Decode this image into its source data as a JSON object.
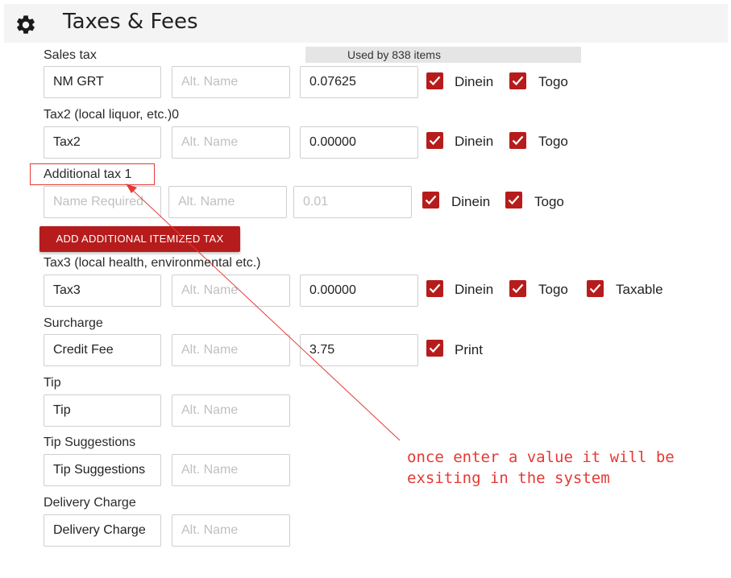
{
  "header": {
    "title": "Taxes & Fees",
    "icon": "gear-icon"
  },
  "used_by": "Used by 838 items",
  "sections": {
    "sales_tax": {
      "label": "Sales tax",
      "name": "NM GRT",
      "alt_placeholder": "Alt. Name",
      "rate": "0.07625",
      "checkboxes": [
        {
          "label": "Dinein",
          "checked": true
        },
        {
          "label": "Togo",
          "checked": true
        }
      ]
    },
    "tax2": {
      "label": "Tax2 (local liquor, etc.)0",
      "name": "Tax2",
      "alt_placeholder": "Alt. Name",
      "rate": "0.00000",
      "checkboxes": [
        {
          "label": "Dinein",
          "checked": true
        },
        {
          "label": "Togo",
          "checked": true
        }
      ]
    },
    "additional_tax": {
      "label": "Additional tax 1",
      "name_placeholder": "Name Required",
      "alt_placeholder": "Alt. Name",
      "rate_placeholder": "0.01",
      "checkboxes": [
        {
          "label": "Dinein",
          "checked": true
        },
        {
          "label": "Togo",
          "checked": true
        }
      ]
    },
    "add_button": "ADD ADDITIONAL ITEMIZED TAX",
    "tax3": {
      "label": "Tax3 (local health, environmental etc.)",
      "name": "Tax3",
      "alt_placeholder": "Alt. Name",
      "rate": "0.00000",
      "checkboxes": [
        {
          "label": "Dinein",
          "checked": true
        },
        {
          "label": "Togo",
          "checked": true
        },
        {
          "label": "Taxable",
          "checked": true
        }
      ]
    },
    "surcharge": {
      "label": "Surcharge",
      "name": "Credit Fee",
      "alt_placeholder": "Alt. Name",
      "rate": "3.75",
      "checkboxes": [
        {
          "label": "Print",
          "checked": true
        }
      ]
    },
    "tip": {
      "label": "Tip",
      "name": "Tip",
      "alt_placeholder": "Alt. Name"
    },
    "tip_suggestions": {
      "label": "Tip Suggestions",
      "name": "Tip Suggestions",
      "alt_placeholder": "Alt. Name"
    },
    "delivery": {
      "label": "Delivery Charge",
      "name": "Delivery Charge",
      "alt_placeholder": "Alt. Name"
    }
  },
  "annotation": {
    "line1": "once enter a value it will be",
    "line2": "exsiting in the system",
    "color": "#e53935"
  },
  "colors": {
    "accent": "#b71c1c",
    "header_bg": "#f4f4f4"
  }
}
